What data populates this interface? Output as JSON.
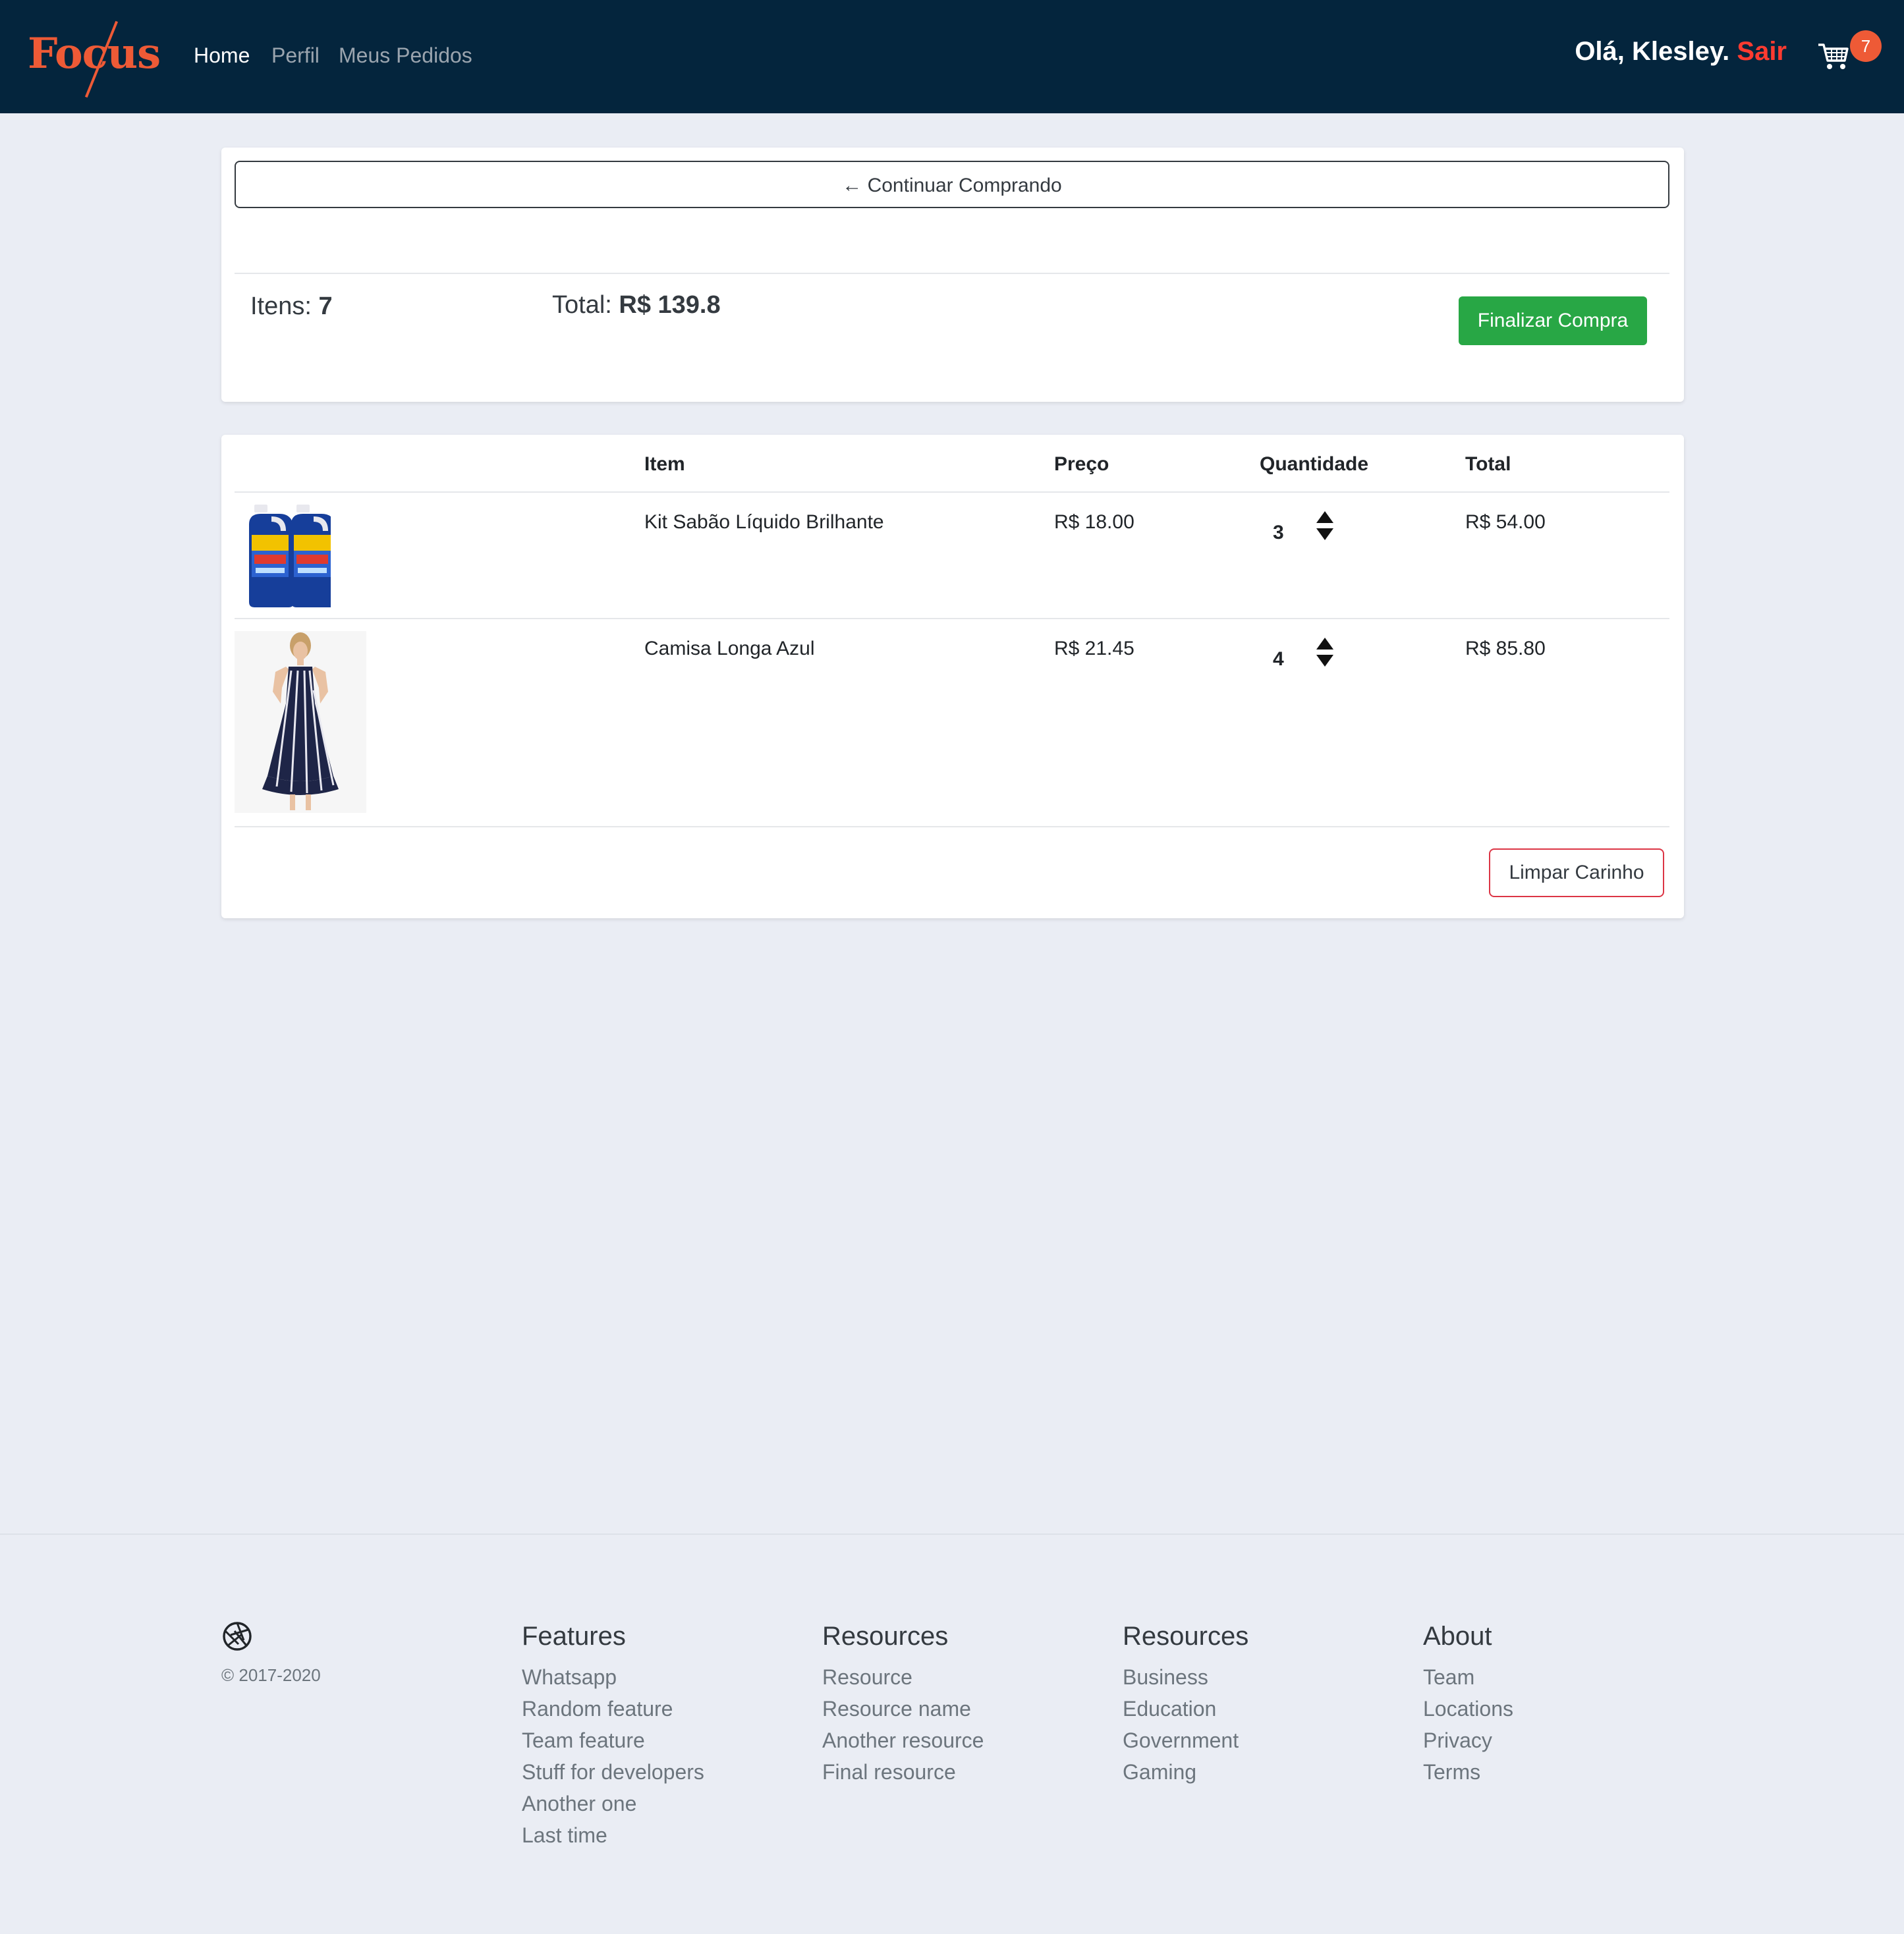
{
  "navbar": {
    "logo_text": "Focus",
    "links": [
      {
        "label": "Home",
        "active": true
      },
      {
        "label": "Perfil",
        "active": false
      },
      {
        "label": "Meus Pedidos",
        "active": false
      }
    ],
    "greeting": "Olá, Klesley.",
    "logout_label": "Sair",
    "cart_icon": "shopping-cart-icon",
    "cart_count": "7"
  },
  "summary": {
    "continue_label": "← Continuar Comprando",
    "items_label": "Itens:",
    "items_count": "7",
    "total_label": "Total:",
    "total_value": "R$ 139.8",
    "checkout_label": "Finalizar Compra"
  },
  "table": {
    "headers": [
      "Item",
      "Preço",
      "Quantidade",
      "Total"
    ],
    "rows": [
      {
        "name": "Kit Sabão Líquido Brilhante",
        "price": "R$ 18.00",
        "quantity": "3",
        "total": "R$ 54.00",
        "image": "detergent-bottles"
      },
      {
        "name": "Camisa Longa Azul",
        "price": "R$ 21.45",
        "quantity": "4",
        "total": "R$ 85.80",
        "image": "striped-dress"
      }
    ],
    "clear_label": "Limpar Carinho"
  },
  "footer": {
    "copyright": "© 2017-2020",
    "logo_icon": "aperture-icon",
    "columns": [
      {
        "title": "Features",
        "links": [
          "Whatsapp",
          "Random feature",
          "Team feature",
          "Stuff for developers",
          "Another one",
          "Last time"
        ]
      },
      {
        "title": "Resources",
        "links": [
          "Resource",
          "Resource name",
          "Another resource",
          "Final resource"
        ]
      },
      {
        "title": "Resources",
        "links": [
          "Business",
          "Education",
          "Government",
          "Gaming"
        ]
      },
      {
        "title": "About",
        "links": [
          "Team",
          "Locations",
          "Privacy",
          "Terms"
        ]
      }
    ]
  },
  "colors": {
    "navbar_bg": "#04253d",
    "brand": "#ee5a36",
    "logout": "#ff3b30",
    "checkout_button": "#28a745",
    "clear_button_border": "#dc3545",
    "page_bg": "#eaedf4"
  }
}
